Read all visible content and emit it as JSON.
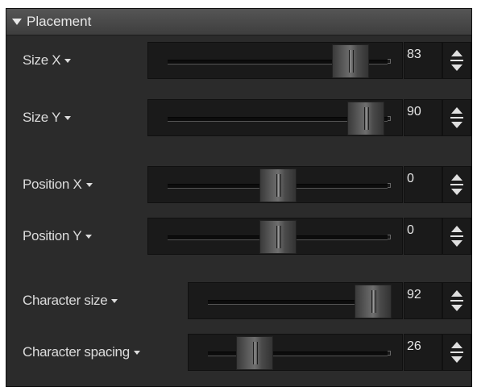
{
  "panel": {
    "title": "Placement"
  },
  "rows": [
    {
      "label": "Size X",
      "value": "83",
      "level": 83
    },
    {
      "label": "Size Y",
      "value": "90",
      "level": 90
    },
    {
      "label": "Position X",
      "value": "0",
      "level": 0
    },
    {
      "label": "Position Y",
      "value": "0",
      "level": 0
    },
    {
      "label": "Character size",
      "value": "92",
      "level": 92
    },
    {
      "label": "Character spacing",
      "value": "26",
      "level": 26
    }
  ]
}
